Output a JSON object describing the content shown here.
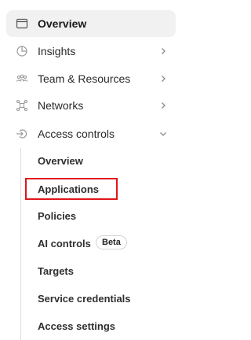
{
  "nav": {
    "items": [
      {
        "label": "Overview",
        "icon": "window-icon",
        "active": true
      },
      {
        "label": "Insights",
        "icon": "chart-clock-icon"
      },
      {
        "label": "Team & Resources",
        "icon": "people-icon"
      },
      {
        "label": "Networks",
        "icon": "network-icon"
      },
      {
        "label": "Access controls",
        "icon": "login-arrow-icon",
        "expanded": true
      }
    ],
    "access_controls": {
      "items": [
        {
          "label": "Overview"
        },
        {
          "label": "Applications",
          "highlighted": true
        },
        {
          "label": "Policies"
        },
        {
          "label": "AI controls",
          "badge": "Beta"
        },
        {
          "label": "Targets"
        },
        {
          "label": "Service credentials"
        },
        {
          "label": "Access settings"
        }
      ]
    }
  },
  "colors": {
    "active_bg": "#f1f1f1",
    "highlight_border": "#e0161b",
    "text": "#2a2a2a",
    "muted_icon": "#9a9a9a"
  }
}
